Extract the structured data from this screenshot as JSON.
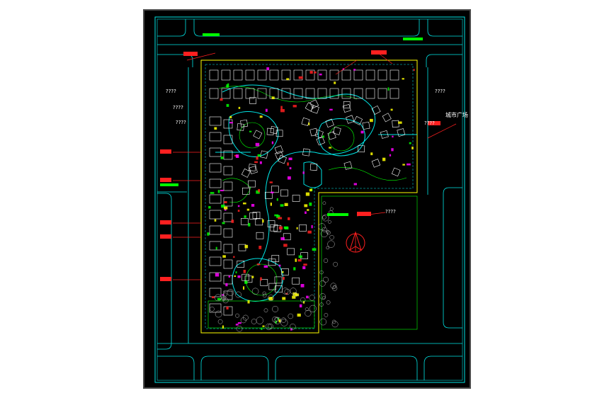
{
  "drawing": {
    "background": "#000000",
    "colors": {
      "border": "#00e5e5",
      "road": "#00e5e5",
      "boundary": "#ffff00",
      "building": "#ffffff",
      "landscape": "#00ff00",
      "annotation": "#ff2020",
      "label_magenta": "#ff00ff",
      "north_arrow": "#ff2020"
    },
    "labels": {
      "plaza_label": "城市广场",
      "placeholder_marks": "????"
    },
    "icons": {
      "north_arrow": "north-arrow-icon"
    }
  }
}
